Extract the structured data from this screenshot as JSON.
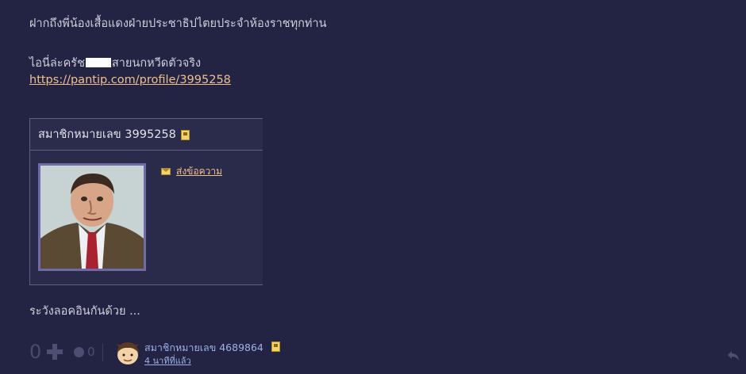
{
  "post": {
    "line1": "ฝากถึงพี่น้องเสื้อแดงฝ่ายประชาธิปไตยประจำห้องราชทุกท่าน",
    "line2_prefix": "ไอนี่ล่ะครัช",
    "line2_suffix": "สายนกหวีดตัวจริง",
    "profile_link": "https://pantip.com/profile/3995258",
    "card": {
      "title": "สมาชิกหมายเลข 3995258",
      "message_link": "ส่งข้อความ"
    },
    "line4": "ระวังลอคอินกันด้วย ..."
  },
  "footer": {
    "vote_count": "0",
    "emotion_count": "0",
    "user_name": "สมาชิกหมายเลข 4689864",
    "time_ago": "4 นาทีที่แล้ว"
  },
  "icons": {
    "plus": "plus-icon",
    "emotion": "emotion-icon",
    "reply": "reply-icon",
    "message": "envelope-icon",
    "badge": "member-badge-icon"
  }
}
